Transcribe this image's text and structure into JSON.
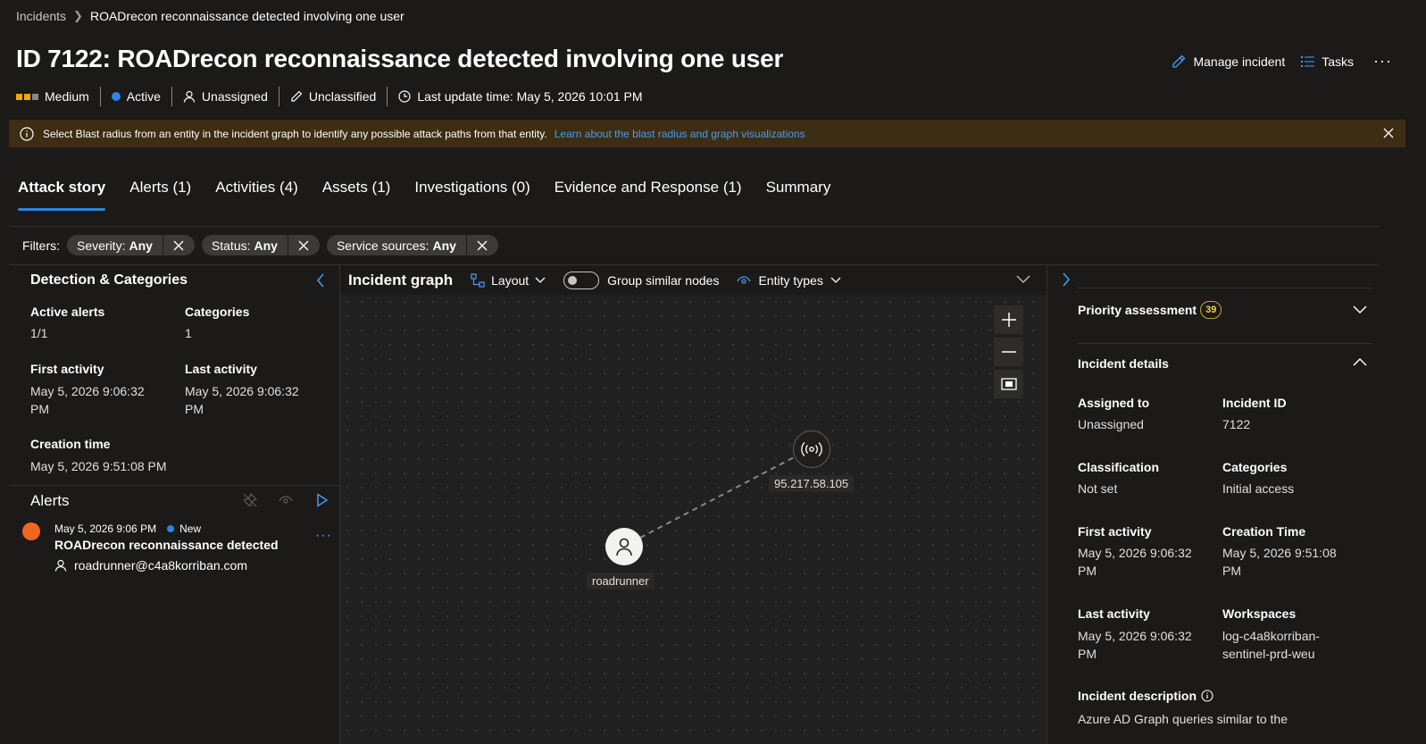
{
  "breadcrumb": {
    "parent": "Incidents",
    "current": "ROADrecon reconnaissance detected involving one user"
  },
  "title": "ID 7122: ROADrecon reconnaissance detected involving one user",
  "actions": {
    "manage": "Manage incident",
    "tasks": "Tasks",
    "more": "···"
  },
  "meta": {
    "severity": "Medium",
    "status": "Active",
    "assigned": "Unassigned",
    "classification": "Unclassified",
    "last_update": "Last update time: May 5, 2026 10:01 PM"
  },
  "banner": {
    "message": "Select Blast radius from an entity in the incident graph to identify any possible attack paths from that entity.",
    "link": "Learn about the blast radius and graph visualizations"
  },
  "tabs": [
    "Attack story",
    "Alerts (1)",
    "Activities (4)",
    "Assets (1)",
    "Investigations (0)",
    "Evidence and Response (1)",
    "Summary"
  ],
  "filters": {
    "label": "Filters:",
    "items": [
      {
        "key": "Severity:",
        "value": "Any"
      },
      {
        "key": "Status:",
        "value": "Any"
      },
      {
        "key": "Service sources:",
        "value": "Any"
      }
    ]
  },
  "detection": {
    "title": "Detection & Categories",
    "active_alerts_label": "Active alerts",
    "active_alerts_value": "1/1",
    "categories_label": "Categories",
    "categories_value": "1",
    "first_activity_label": "First activity",
    "first_activity_value": "May 5, 2026 9:06:32 PM",
    "last_activity_label": "Last activity",
    "last_activity_value": "May 5, 2026 9:06:32 PM",
    "creation_label": "Creation time",
    "creation_value": "May 5, 2026 9:51:08 PM"
  },
  "alerts": {
    "title": "Alerts",
    "item": {
      "time": "May 5, 2026 9:06 PM",
      "status": "New",
      "name": "ROADrecon reconnaissance detected",
      "user": "roadrunner@c4a8korriban.com",
      "more": "···"
    }
  },
  "graph": {
    "title": "Incident graph",
    "layout": "Layout",
    "group": "Group similar nodes",
    "entity_types": "Entity types",
    "nodes": {
      "ip": "95.217.58.105",
      "user": "roadrunner"
    }
  },
  "right": {
    "priority": "Priority assessment",
    "priority_score": "39",
    "details_title": "Incident details",
    "assigned_label": "Assigned to",
    "assigned_value": "Unassigned",
    "id_label": "Incident ID",
    "id_value": "7122",
    "class_label": "Classification",
    "class_value": "Not set",
    "cat_label": "Categories",
    "cat_value": "Initial access",
    "first_label": "First activity",
    "first_value": "May 5, 2026 9:06:32 PM",
    "creation_label": "Creation Time",
    "creation_value": "May 5, 2026 9:51:08 PM",
    "last_label": "Last activity",
    "last_value": "May 5, 2026 9:06:32 PM",
    "ws_label": "Workspaces",
    "ws_value": "log-c4a8korriban-sentinel-prd-weu",
    "desc_label": "Incident description",
    "desc_value": "Azure AD Graph queries similar to the"
  },
  "colors": {
    "accent": "#2886de",
    "severity_on": "#f7a600",
    "alert_dot": "#f2671f",
    "banner_bg": "#3d2d12",
    "badge": "#c4a72b"
  }
}
